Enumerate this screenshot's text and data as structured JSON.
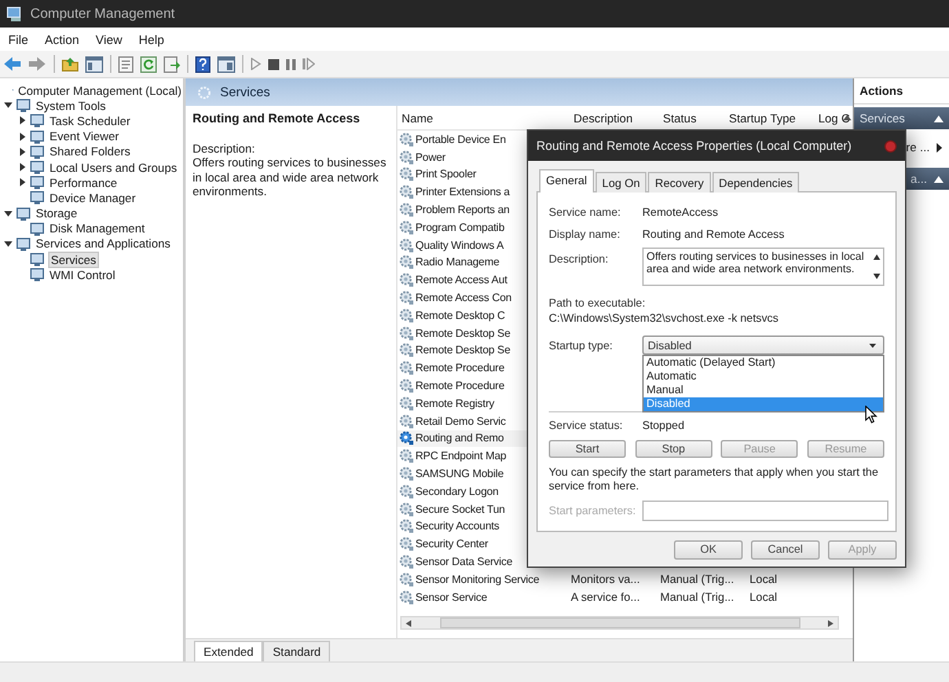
{
  "window": {
    "title": "Computer Management"
  },
  "menu": [
    "File",
    "Action",
    "View",
    "Help"
  ],
  "tree": [
    {
      "label": "Computer Management (Local)",
      "selected": false,
      "children": [
        {
          "label": "System Tools",
          "selected": false,
          "expanded": true,
          "children": [
            {
              "label": "Task Scheduler",
              "selected": false,
              "expanded": false
            },
            {
              "label": "Event Viewer",
              "selected": false,
              "expanded": false
            },
            {
              "label": "Shared Folders",
              "selected": false,
              "expanded": false
            },
            {
              "label": "Local Users and Groups",
              "selected": false,
              "expanded": false
            },
            {
              "label": "Performance",
              "selected": false,
              "expanded": false
            },
            {
              "label": "Device Manager",
              "selected": false
            }
          ]
        },
        {
          "label": "Storage",
          "selected": false,
          "expanded": true,
          "children": [
            {
              "label": "Disk Management",
              "selected": false
            }
          ]
        },
        {
          "label": "Services and Applications",
          "selected": false,
          "expanded": true,
          "children": [
            {
              "label": "Services",
              "selected": true
            },
            {
              "label": "WMI Control",
              "selected": false
            }
          ]
        }
      ]
    }
  ],
  "services_header": {
    "title": "Services"
  },
  "detail": {
    "title": "Routing and Remote Access",
    "description_label": "Description:",
    "description": "Offers routing services to businesses in local area and wide area network environments."
  },
  "table": {
    "columns": [
      "Name",
      "Description",
      "Status",
      "Startup Type",
      "Log C"
    ],
    "rows": [
      {
        "name": "Portable Device En",
        "selected": false
      },
      {
        "name": "Power",
        "selected": false
      },
      {
        "name": "Print Spooler",
        "selected": false
      },
      {
        "name": "Printer Extensions a",
        "selected": false
      },
      {
        "name": "Problem Reports an",
        "selected": false
      },
      {
        "name": "Program Compatib",
        "selected": false
      },
      {
        "name": "Quality Windows A",
        "selected": false
      },
      {
        "name": "Radio Manageme",
        "selected": false
      },
      {
        "name": "Remote Access Aut",
        "selected": false
      },
      {
        "name": "Remote Access Con",
        "selected": false
      },
      {
        "name": "Remote Desktop C",
        "selected": false
      },
      {
        "name": "Remote Desktop Se",
        "selected": false
      },
      {
        "name": "Remote Desktop Se",
        "selected": false
      },
      {
        "name": "Remote Procedure",
        "selected": false
      },
      {
        "name": "Remote Procedure",
        "selected": false
      },
      {
        "name": "Remote Registry",
        "selected": false
      },
      {
        "name": "Retail Demo Servic",
        "selected": false
      },
      {
        "name": "Routing and Remo",
        "selected": true
      },
      {
        "name": "RPC Endpoint Map",
        "selected": false
      },
      {
        "name": "SAMSUNG Mobile",
        "selected": false
      },
      {
        "name": "Secondary Logon",
        "selected": false
      },
      {
        "name": "Secure Socket Tun",
        "selected": false
      },
      {
        "name": "Security Accounts",
        "selected": false
      },
      {
        "name": "Security Center",
        "selected": false
      },
      {
        "name": "Sensor Data Service",
        "selected": false
      },
      {
        "name": "Sensor Monitoring Service",
        "description": "Monitors va...",
        "startup_type": "Manual (Trig...",
        "log_on": "Local",
        "selected": false
      },
      {
        "name": "Sensor Service",
        "description": "A service fo...",
        "startup_type": "Manual (Trig...",
        "log_on": "Local",
        "selected": false
      }
    ]
  },
  "view_tabs": [
    {
      "label": "Extended",
      "selected": true
    },
    {
      "label": "Standard",
      "selected": false
    }
  ],
  "actions": {
    "title": "Actions",
    "items": [
      {
        "kind": "section",
        "label": "Services"
      },
      {
        "kind": "item",
        "label": "re ..."
      },
      {
        "kind": "section",
        "label": "a..."
      }
    ]
  },
  "dialog": {
    "title": "Routing and Remote Access Properties (Local Computer)",
    "tabs": [
      {
        "label": "General",
        "selected": true
      },
      {
        "label": "Log On",
        "selected": false
      },
      {
        "label": "Recovery",
        "selected": false
      },
      {
        "label": "Dependencies",
        "selected": false
      }
    ],
    "fields": [
      {
        "label": "Service name:",
        "value": "RemoteAccess"
      },
      {
        "label": "Display name:",
        "value": "Routing and Remote Access"
      }
    ],
    "description": {
      "label": "Description:",
      "value": "Offers routing services to businesses in local area and wide area network environments."
    },
    "path": {
      "label": "Path to executable:",
      "value": "C:\\Windows\\System32\\svchost.exe -k netsvcs"
    },
    "startup": {
      "label": "Startup type:",
      "value": "Disabled",
      "options": [
        {
          "label": "Automatic (Delayed Start)",
          "selected": false
        },
        {
          "label": "Automatic",
          "selected": false
        },
        {
          "label": "Manual",
          "selected": false
        },
        {
          "label": "Disabled",
          "selected": true
        }
      ]
    },
    "status": {
      "label": "Service status:",
      "value": "Stopped"
    },
    "service_buttons": [
      {
        "label": "Start",
        "disabled": false
      },
      {
        "label": "Stop",
        "disabled": false
      },
      {
        "label": "Pause",
        "disabled": true
      },
      {
        "label": "Resume",
        "disabled": true
      }
    ],
    "hint": "You can specify the start parameters that apply when you start the service from here.",
    "parameters": {
      "label": "Start parameters:",
      "disabled": true
    },
    "buttons": [
      {
        "label": "OK",
        "disabled": false
      },
      {
        "label": "Cancel",
        "disabled": false
      },
      {
        "label": "Apply",
        "disabled": true
      }
    ]
  }
}
